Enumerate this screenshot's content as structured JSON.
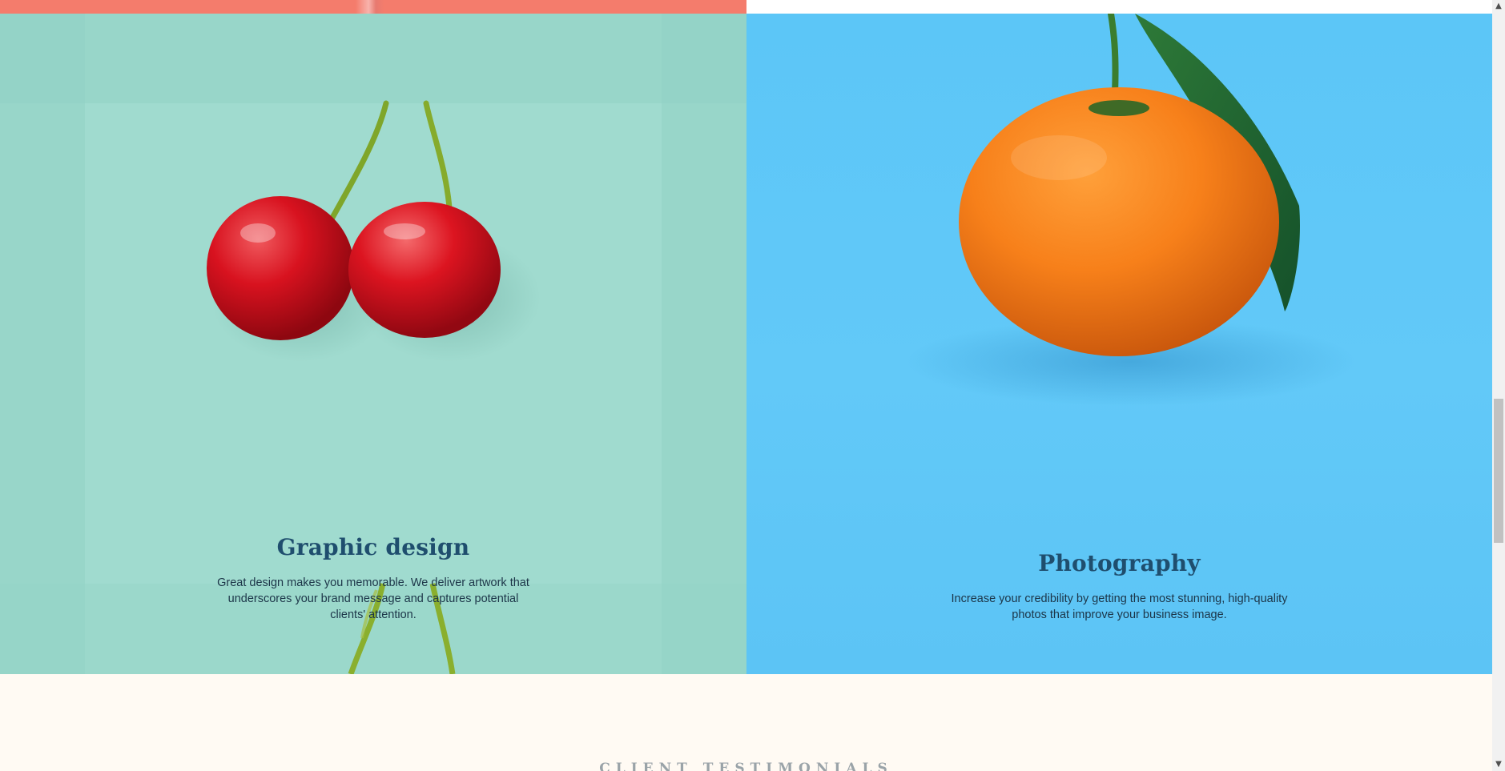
{
  "services": [
    {
      "title": "Graphic design",
      "description": "Great design makes you memorable. We deliver artwork that underscores your brand message and captures potential clients' attention."
    },
    {
      "title": "Photography",
      "description": "Increase your credibility by getting the most stunning, high-quality photos that improve your business image."
    }
  ],
  "testimonials": {
    "heading": "CLIENT TESTIMONIALS"
  },
  "colors": {
    "graphic_bg": "#9cd9cc",
    "photo_bg": "#5cc6f7",
    "title": "#1f4e6e",
    "coral": "#f47c6c",
    "cream": "#fffaf3"
  },
  "scrollbar": {
    "up_icon": "chevron-up-icon",
    "down_icon": "chevron-down-icon"
  }
}
